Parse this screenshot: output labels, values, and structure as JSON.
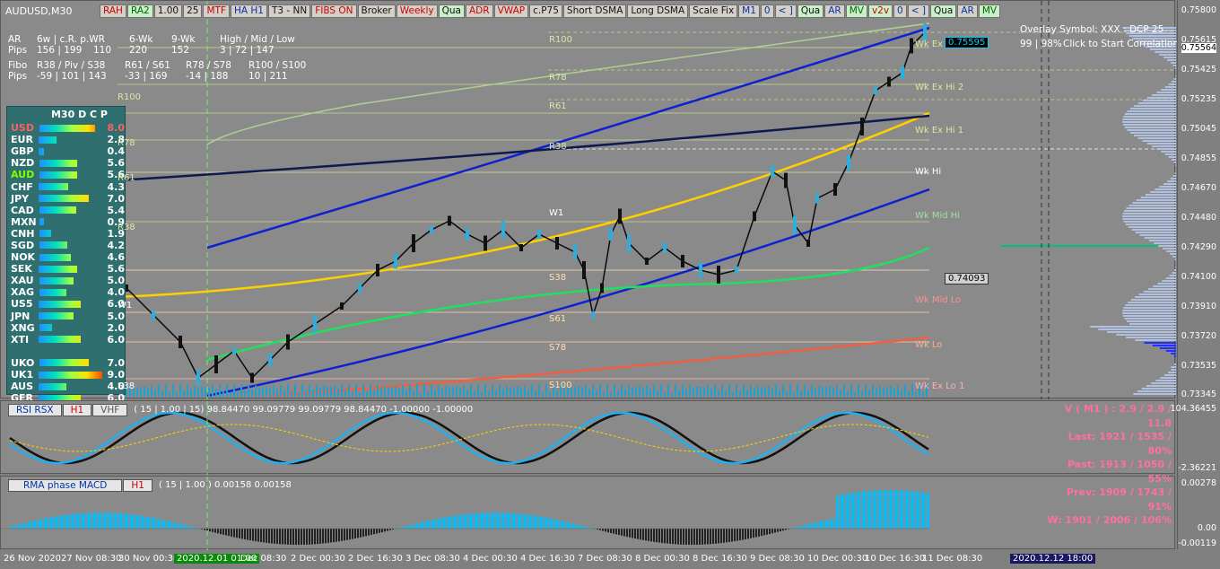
{
  "symbol": "AUDUSD,M30",
  "toolbar": [
    "RAH",
    "RA2",
    "1.00",
    "25",
    "MTF",
    "HA H1",
    "T3 - NN",
    "FIBS ON",
    "Broker",
    "Weekly",
    "Qua",
    "ADR",
    "VWAP",
    "c.P75",
    "Short DSMA",
    "Long DSMA",
    "Scale Fix",
    "M1",
    "0",
    "< ]",
    "Qua",
    "AR",
    "MV",
    "v2v",
    "0",
    "< ]",
    "Qua",
    "AR",
    "MV"
  ],
  "info": {
    "ar_label": "AR",
    "ar_cols": "6w | c.R.   p.WR",
    "ar_cols2": "6-Wk",
    "ar_cols3": "9-Wk",
    "hml": "High / Mid / Low",
    "pips_label": "Pips",
    "pips_vals": "156 | 199",
    "pwr": "110",
    "w6": "220",
    "w9": "152",
    "hml_vals": "3  |  72  |  147",
    "fibo": "Fibo",
    "fibo_cols": "R38 / Piv / S38",
    "fibo_c2": "R61 / S61",
    "fibo_c3": "R78 / S78",
    "fibo_c4": "R100 / S100",
    "fpips": "Pips",
    "fv1": "-59  |  101  |  143",
    "fv2": "-33  |  169",
    "fv3": "-14  |  188",
    "fv4": "10  |  211"
  },
  "overlay": {
    "line1": "Overlay Symbol: XXX : DCP 25",
    "line2a": "99 | 98%",
    "line2b": "Click to Start Correlation"
  },
  "strength": {
    "title": "M30   D C P",
    "rows": [
      {
        "c": "USD",
        "v": "8.0",
        "col": "#ff6060",
        "w": 0.9
      },
      {
        "c": "EUR",
        "v": "2.8",
        "col": "#fff",
        "w": 0.3
      },
      {
        "c": "GBP",
        "v": "0.4",
        "col": "#fff",
        "w": 0.1
      },
      {
        "c": "NZD",
        "v": "5.6",
        "col": "#fff",
        "w": 0.62
      },
      {
        "c": "AUD",
        "v": "5.6",
        "col": "#7fff00",
        "w": 0.62
      },
      {
        "c": "CHF",
        "v": "4.3",
        "col": "#fff",
        "w": 0.48
      },
      {
        "c": "JPY",
        "v": "7.0",
        "col": "#fff",
        "w": 0.8
      },
      {
        "c": "CAD",
        "v": "5.4",
        "col": "#fff",
        "w": 0.6
      },
      {
        "c": "MXN",
        "v": "0.9",
        "col": "#fff",
        "w": 0.1
      },
      {
        "c": "CNH",
        "v": "1.9",
        "col": "#fff",
        "w": 0.22
      },
      {
        "c": "SGD",
        "v": "4.2",
        "col": "#fff",
        "w": 0.47
      },
      {
        "c": "NOK",
        "v": "4.6",
        "col": "#fff",
        "w": 0.52
      },
      {
        "c": "SEK",
        "v": "5.6",
        "col": "#fff",
        "w": 0.62
      },
      {
        "c": "XAU",
        "v": "5.0",
        "col": "#fff",
        "w": 0.56
      },
      {
        "c": "XAG",
        "v": "4.0",
        "col": "#fff",
        "w": 0.45
      },
      {
        "c": "US5",
        "v": "6.0",
        "col": "#fff",
        "w": 0.67
      },
      {
        "c": "JPN",
        "v": "5.0",
        "col": "#fff",
        "w": 0.56
      },
      {
        "c": "XNG",
        "v": "2.0",
        "col": "#fff",
        "w": 0.23
      },
      {
        "c": "XTI",
        "v": "6.0",
        "col": "#fff",
        "w": 0.67
      },
      {
        "c": "",
        "v": "",
        "col": "#fff",
        "w": 0
      },
      {
        "c": "UKO",
        "v": "7.0",
        "col": "#fff",
        "w": 0.8
      },
      {
        "c": "UK1",
        "v": "9.0",
        "col": "#fff",
        "w": 1.0
      },
      {
        "c": "AUS",
        "v": "4.0",
        "col": "#fff",
        "w": 0.45
      },
      {
        "c": "GER",
        "v": "6.0",
        "col": "#fff",
        "w": 0.67
      }
    ]
  },
  "price_axis": [
    "0.75800",
    "0.75615",
    "0.75564",
    "0.75425",
    "0.75235",
    "0.75045",
    "0.74855",
    "0.74670",
    "0.74480",
    "0.74290",
    "0.74100",
    "0.73910",
    "0.73720",
    "0.73535",
    "0.73345"
  ],
  "price_boxes": {
    "current": "0.75595",
    "mid": "0.74093"
  },
  "levels_left": [
    "R100",
    "R78",
    "R61",
    "R38",
    "W1",
    "S38"
  ],
  "levels_mid": [
    "R100",
    "R78",
    "R61",
    "R38",
    "W1",
    "S38",
    "S61",
    "S78",
    "S100"
  ],
  "weekly": [
    "Wk Ex Hi 3",
    "Wk Ex Hi 2",
    "Wk Ex Hi 1",
    "Wk Hi",
    "Wk Mid Hi",
    "Wk Mid Lo",
    "Wk Lo",
    "Wk Ex Lo 1"
  ],
  "rsi": {
    "name": "RSI RSX",
    "tf": "H1",
    "ind": "VHF",
    "params": "( 15 | 1.00 | 15) 98.84470 99.09779 99.09779 98.84470 -1.00000 -1.00000",
    "axis_top": "104.36455",
    "axis_bot": "-2.36221"
  },
  "stats": [
    "V ( M1 ) : 2.9 / 2.9 / 11.8",
    "Last: 1921 / 1535 / 80%",
    "Past: 1913 / 1050 / 55%",
    "Prev: 1909 / 1743 / 91%",
    "W: 1901 / 2006 / 106%"
  ],
  "macd": {
    "name": "RMA phase MACD",
    "tf": "H1",
    "params": "( 15 | 1.00 ) 0.00158 0.00158",
    "ax1": "0.00278",
    "ax2": "0.00",
    "ax3": "-0.00119"
  },
  "time_ticks": [
    "26 Nov 2020",
    "27 Nov 08:30",
    "30 Nov 00:30",
    "2020.12.01 01:00",
    "Dec 08:30",
    "2 Dec 00:30",
    "2 Dec 16:30",
    "3 Dec 08:30",
    "4 Dec 00:30",
    "4 Dec 16:30",
    "7 Dec 08:30",
    "8 Dec 00:30",
    "8 Dec 16:30",
    "9 Dec 08:30",
    "10 Dec 00:30",
    "10 Dec 16:30",
    "11 Dec 08:30",
    "2020.12.12 18:00"
  ]
}
